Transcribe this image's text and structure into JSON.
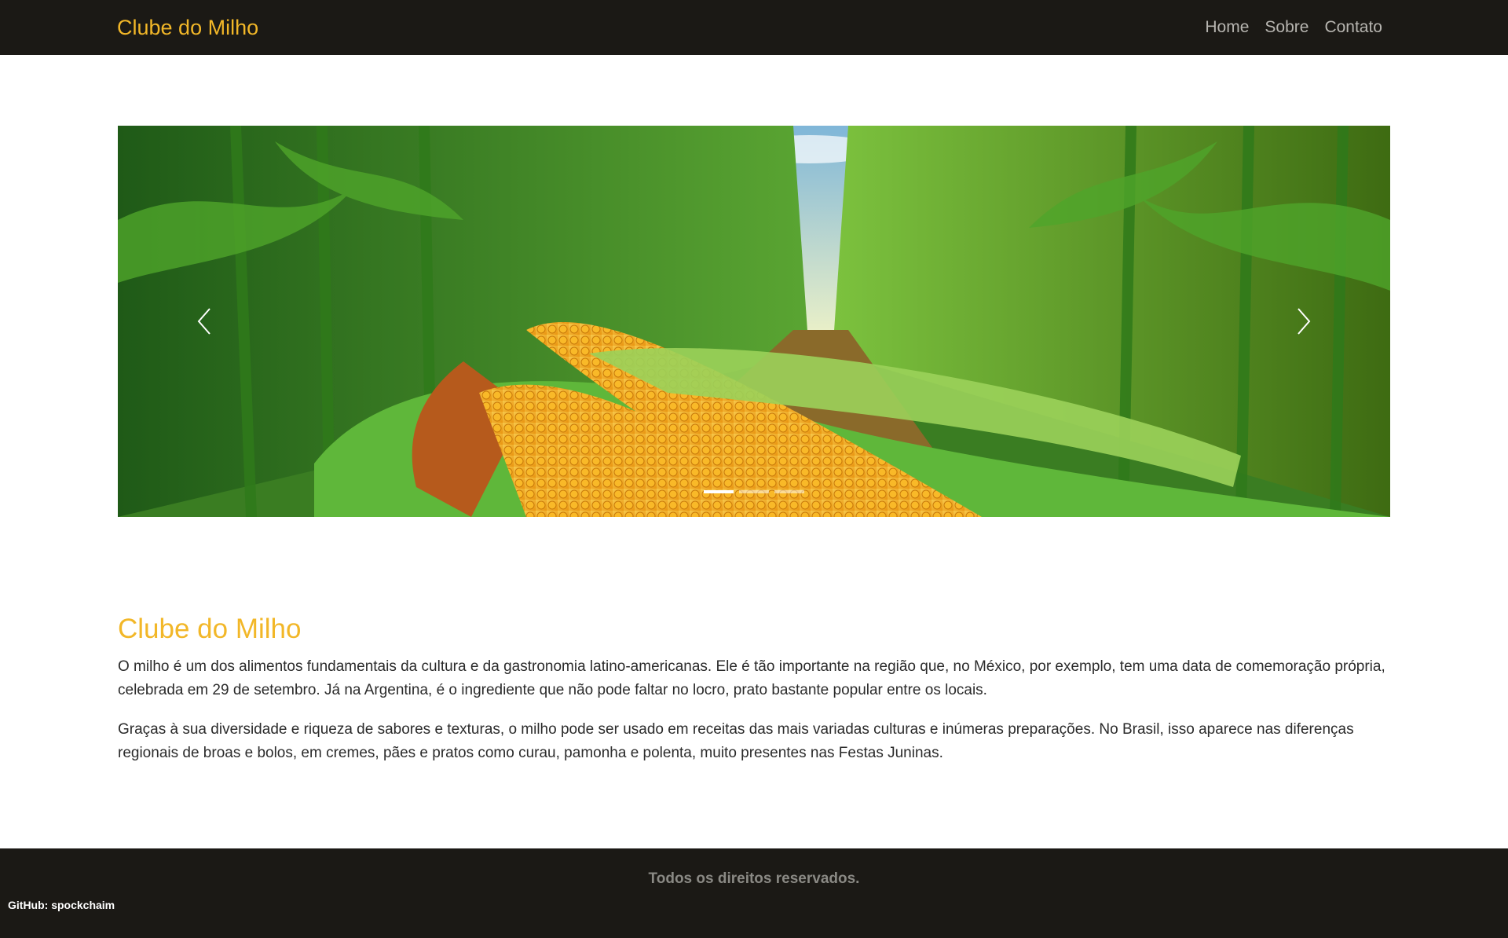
{
  "navbar": {
    "brand": "Clube do Milho",
    "links": [
      "Home",
      "Sobre",
      "Contato"
    ]
  },
  "carousel": {
    "slide_count": 3,
    "active_index": 0,
    "prev_icon": "chevron-left-icon",
    "next_icon": "chevron-right-icon"
  },
  "main": {
    "title": "Clube do Milho",
    "paragraphs": [
      "O milho é um dos alimentos fundamentais da cultura e da gastronomia latino-americanas. Ele é tão importante na região que, no México, por exemplo, tem uma data de comemoração própria, celebrada em 29 de setembro. Já na Argentina, é o ingrediente que não pode faltar no locro, prato bastante popular entre os locais.",
      "Graças à sua diversidade e riqueza de sabores e texturas, o milho pode ser usado em receitas das mais variadas culturas e inúmeras preparações. No Brasil, isso aparece nas diferenças regionais de broas e bolos, em cremes, pães e pratos como curau, pamonha e polenta, muito presentes nas Festas Juninas."
    ]
  },
  "footer": {
    "text": "Todos os direitos reservados.",
    "github": "GitHub: spockchaim"
  },
  "colors": {
    "brand": "#f2b728",
    "dark": "#1b1915"
  }
}
